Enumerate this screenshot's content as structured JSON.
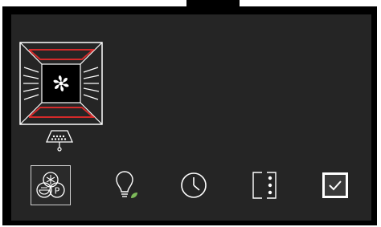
{
  "colors": {
    "screen": "#252525",
    "bezel": "#000000",
    "icon": "#ffffff",
    "heating_element": "#d42a2a",
    "leaf_accent": "#7dba5a"
  },
  "oven_display": {
    "mode_icon": "fan-icon",
    "heating_elements": [
      "top",
      "bottom"
    ],
    "accessory_icon": "baking-tray-icon"
  },
  "function_bar": {
    "buttons": [
      {
        "id": "modes",
        "icon": "defrost-proof-modes-icon",
        "selected": true
      },
      {
        "id": "eco",
        "icon": "eco-bulb-icon",
        "selected": false
      },
      {
        "id": "timer",
        "icon": "clock-icon",
        "selected": false
      },
      {
        "id": "more",
        "icon": "more-options-icon",
        "selected": false
      },
      {
        "id": "confirm",
        "icon": "checkbox-icon",
        "selected": false
      }
    ]
  }
}
